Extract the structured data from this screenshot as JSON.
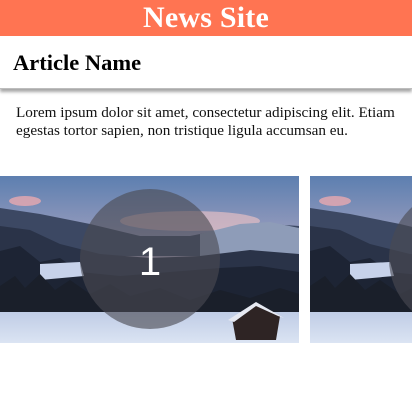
{
  "header": {
    "title": "News Site"
  },
  "article": {
    "title": "Article Name",
    "body": "Lorem ipsum dolor sit amet, consectetur adipiscing elit. Etiam egestas tortor sapien, non tristique ligula accumsan eu."
  },
  "carousel": {
    "slides": [
      {
        "number": "1"
      },
      {
        "number": ""
      }
    ]
  },
  "colors": {
    "header_bg": "#ff7452",
    "header_text": "#ffffff"
  }
}
